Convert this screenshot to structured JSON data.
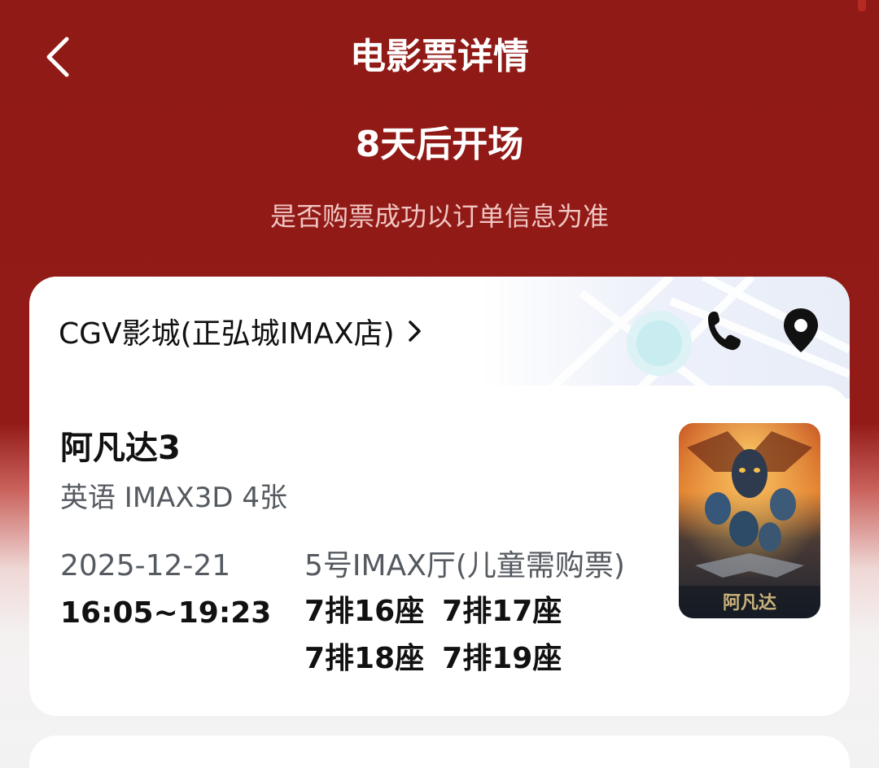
{
  "header": {
    "title": "电影票详情",
    "countdown": "8天后开场",
    "notice": "是否购票成功以订单信息为准"
  },
  "cinema": {
    "name": "CGV影城(正弘城IMAX店)"
  },
  "ticket": {
    "movie_title": "阿凡达3",
    "meta": "英语 IMAX3D 4张",
    "date": "2025-12-21",
    "time": "16:05~19:23",
    "hall": "5号IMAX厅(儿童需购票)",
    "seats": [
      "7排16座",
      "7排17座",
      "7排18座",
      "7排19座"
    ],
    "poster_text": "阿凡达"
  },
  "icons": {
    "back": "chevron-left-icon",
    "cinema_arrow": "chevron-right-icon",
    "phone": "phone-icon",
    "location": "location-pin-icon"
  },
  "colors": {
    "header_bg": "#921b17",
    "text_primary": "#111111",
    "text_secondary": "#555a60",
    "notice_text": "#f0c5c2"
  }
}
